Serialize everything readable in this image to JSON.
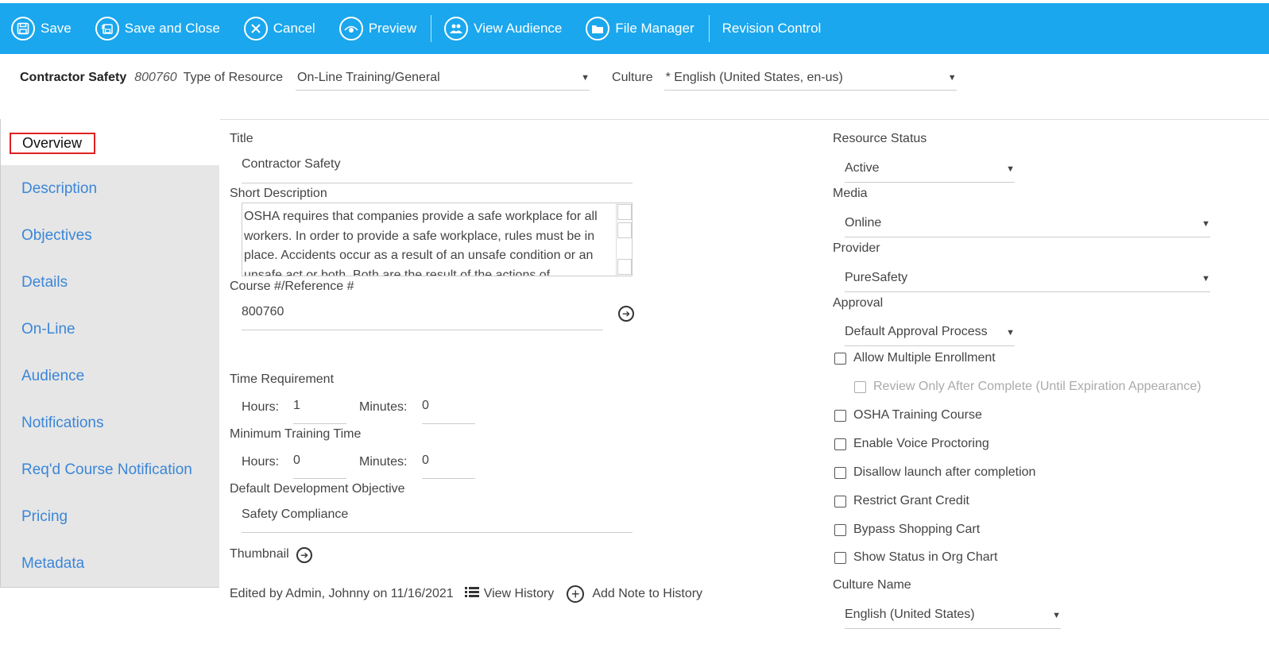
{
  "toolbar": {
    "save": "Save",
    "save_close": "Save and Close",
    "cancel": "Cancel",
    "preview": "Preview",
    "view_audience": "View Audience",
    "file_manager": "File Manager",
    "revision_control": "Revision Control"
  },
  "header": {
    "resource_name": "Contractor Safety",
    "resource_code": "800760",
    "type_label": "Type of Resource",
    "type_value": "On-Line Training/General",
    "culture_label": "Culture",
    "culture_value": "* English (United States, en-us)"
  },
  "sidebar": {
    "active": "Overview",
    "items": [
      "Description",
      "Objectives",
      "Details",
      "On-Line",
      "Audience",
      "Notifications",
      "Req'd Course Notification",
      "Pricing",
      "Metadata"
    ]
  },
  "form": {
    "title_label": "Title",
    "title_value": "Contractor Safety",
    "short_desc_label": "Short Description",
    "short_desc_value": "OSHA requires that companies provide a safe workplace for all workers. In order to provide a safe workplace, rules must be in place. Accidents occur as a result of an unsafe condition or an unsafe act or both. Both are the result of the actions of",
    "course_ref_label": "Course #/Reference #",
    "course_ref_value": "800760",
    "time_req_label": "Time Requirement",
    "hours_label": "Hours:",
    "minutes_label": "Minutes:",
    "time_req_hours": "1",
    "time_req_minutes": "0",
    "min_time_label": "Minimum Training Time",
    "min_time_hours": "0",
    "min_time_minutes": "0",
    "dev_obj_label": "Default Development Objective",
    "dev_obj_value": "Safety Compliance",
    "thumbnail_label": "Thumbnail"
  },
  "footer": {
    "edited_by": "Edited by Admin, Johnny on 11/16/2021",
    "view_history": "View History",
    "add_note": "Add Note to History"
  },
  "right": {
    "status_label": "Resource Status",
    "status_value": "Active",
    "media_label": "Media",
    "media_value": "Online",
    "provider_label": "Provider",
    "provider_value": "PureSafety",
    "approval_label": "Approval",
    "approval_value": "Default Approval Process",
    "checkboxes": {
      "allow_multiple": "Allow Multiple Enrollment",
      "review_only": "Review Only After Complete (Until Expiration Appearance)",
      "osha": "OSHA Training Course",
      "voice": "Enable Voice Proctoring",
      "disallow": "Disallow launch after completion",
      "restrict": "Restrict Grant Credit",
      "bypass": "Bypass Shopping Cart",
      "org_chart": "Show Status in Org Chart"
    },
    "culture_name_label": "Culture Name",
    "culture_name_value": "English (United States)"
  },
  "colors": {
    "toolbar": "#1aa7ee",
    "link": "#3b86d8",
    "active_border": "#e02020"
  }
}
